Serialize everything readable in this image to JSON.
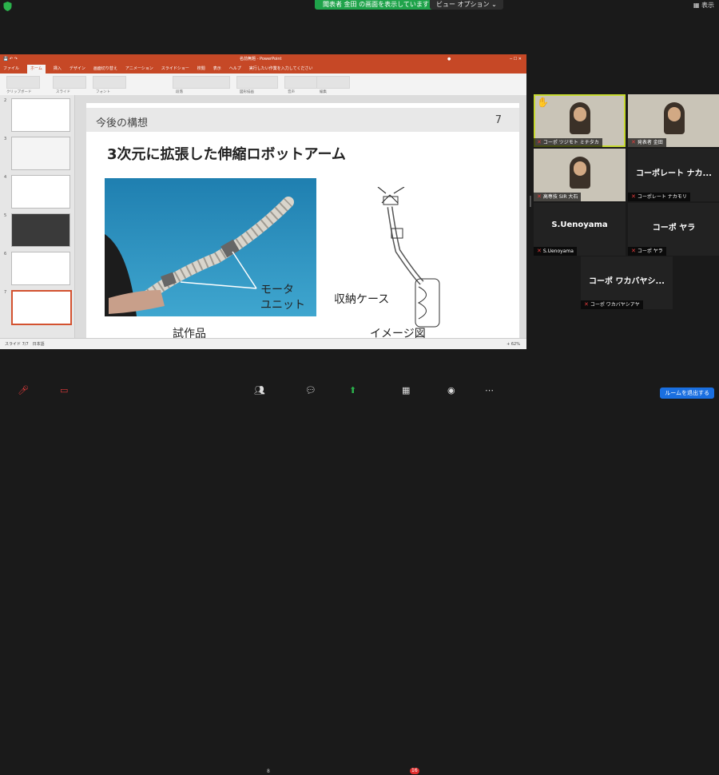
{
  "topbar": {
    "share_banner": "聞表者 金田 の画面を表示しています",
    "view_options": "ビュー オプション ⌄",
    "display_label": "表示"
  },
  "powerpoint": {
    "title_filename": "名前無題 - PowerPoint",
    "tabs": [
      "ファイル",
      "ホーム",
      "挿入",
      "デザイン",
      "画面切り替え",
      "アニメーション",
      "スライドショー",
      "校閲",
      "表示",
      "ヘルプ",
      "実行したい作業を入力してください"
    ],
    "ribbon_groups": [
      "クリップボード",
      "スライド",
      "フォント",
      "段落",
      "図形描画",
      "音声",
      "編集"
    ],
    "thumbnail_numbers": [
      "2",
      "3",
      "4",
      "5",
      "6",
      "7"
    ],
    "status_left": "スライド 7/7　日本語",
    "status_zoom": "+ 62%"
  },
  "slide": {
    "header_title": "今後の構想",
    "page_number": "7",
    "main_title": "3次元に拡張した伸縮ロボットアーム",
    "motor_label_1": "モータ",
    "motor_label_2": "ユニット",
    "case_label": "収納ケース",
    "caption_left": "試作品",
    "caption_right": "イメージ図"
  },
  "participants": [
    {
      "name": "コーポ ツジモト ミチタカ",
      "type": "video",
      "active": true,
      "hand": true
    },
    {
      "name": "発表者 金田",
      "type": "video",
      "active": false
    },
    {
      "name": "高専技 SIR 大石",
      "type": "video",
      "active": false
    },
    {
      "name": "コーポレート ナカモリ",
      "big": "コーポレート ナカ...",
      "type": "name"
    },
    {
      "name": "S.Uenoyama",
      "big": "S.Uenoyama",
      "type": "name"
    },
    {
      "name": "コーポ ヤラ",
      "big": "コーポ ヤラ",
      "type": "name"
    },
    {
      "name": "コーポ ワカバヤシアヤ",
      "big": "コーポ ワカバヤシ...",
      "type": "name"
    }
  ],
  "bottombar": {
    "participants_count": "8",
    "chat_badge": "16",
    "leave_button": "ルームを退出する"
  },
  "colors": {
    "ppt_accent": "#c64826",
    "share_green": "#1fa34a",
    "active_speaker": "#c6d92f",
    "leave_blue": "#1a6fe0"
  }
}
